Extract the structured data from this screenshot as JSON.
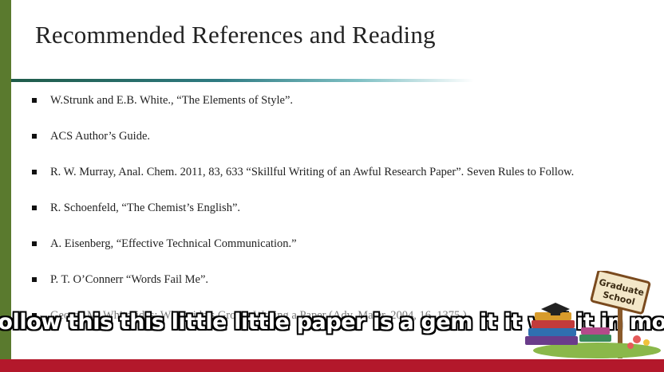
{
  "slide": {
    "title": "Recommended References and Reading",
    "references": [
      "W.Strunk and E.B.  White., “The Elements of Style”.",
      "ACS Author’s Guide.",
      "R. W. Murray, Anal. Chem. 2011, 83, 633 “Skillful Writing of an Awful Research Paper”. Seven Rules to Follow.",
      "R. Schoenfeld, “The Chemist’s English”.",
      "A. Eisenberg, “Effective Technical Communication.”",
      "P. T. O’Connerr “Words Fail Me”.",
      "George M. Whitesides: Whiteside’s Group: Writing a Paper (Adv. Mater. 2004, 16, 1375.)"
    ]
  },
  "caption": {
    "text": "follow this this little little paper is a gem it it will it in mock style tell"
  },
  "logo": {
    "sign_line1": "Graduate",
    "sign_line2": "School"
  },
  "colors": {
    "left_bar": "#5a7a2e",
    "bottom_bar": "#b3182b",
    "title_rule": "#2f7b82"
  }
}
